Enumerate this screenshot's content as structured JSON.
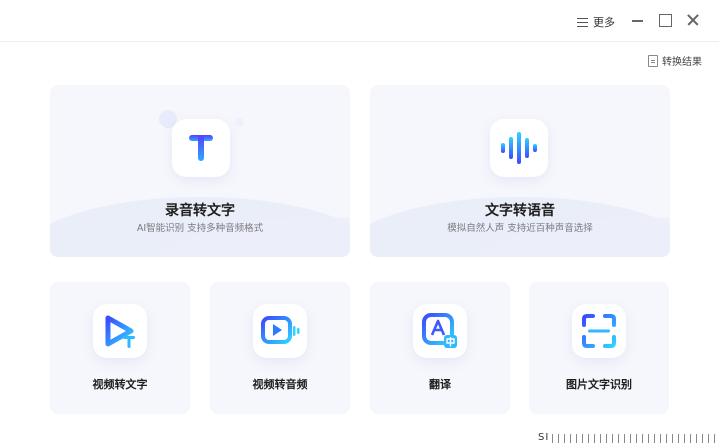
{
  "titlebar": {
    "more_label": "更多"
  },
  "toolbar": {
    "results_label": "转换结果"
  },
  "features": {
    "record_to_text": {
      "title": "录音转文字",
      "subtitle": "AI智能识别 支持多种音频格式"
    },
    "text_to_speech": {
      "title": "文字转语音",
      "subtitle": "模拟自然人声 支持近百种声音选择"
    },
    "video_to_text": {
      "title": "视频转文字"
    },
    "video_to_audio": {
      "title": "视频转音频"
    },
    "translate": {
      "title": "翻译"
    },
    "image_ocr": {
      "title": "图片文字识别"
    }
  },
  "watermark": "SI",
  "colors": {
    "accent_start": "#3b4bff",
    "accent_end": "#2fd3ff",
    "card_bg": "#f6f7fc"
  },
  "icons": {
    "more": "hamburger-icon",
    "results": "document-icon",
    "record_to_text": "letter-t-icon",
    "text_to_speech": "sound-wave-icon",
    "video_to_text": "play-t-icon",
    "video_to_audio": "video-audio-icon",
    "translate": "translate-icon",
    "image_ocr": "scan-icon"
  }
}
